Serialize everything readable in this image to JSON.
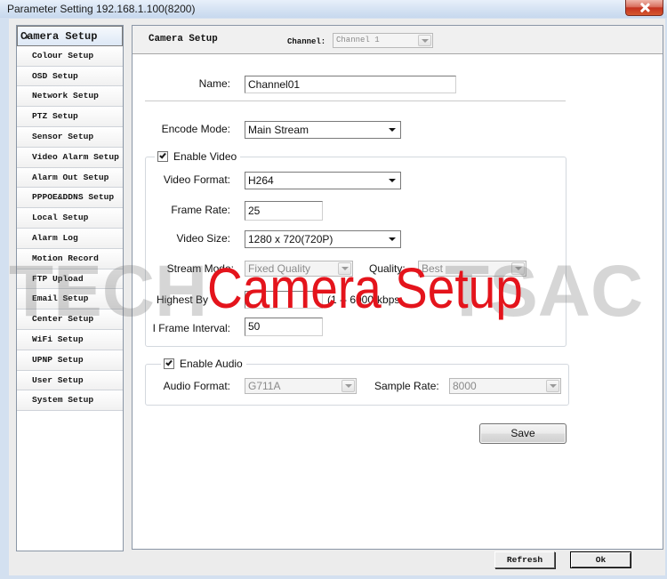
{
  "window": {
    "title": "Parameter Setting 192.168.1.100(8200)",
    "close_icon": "close-icon"
  },
  "sidebar": {
    "selected_icon": "triangle-right-icon",
    "items": [
      {
        "label": "Camera Setup",
        "selected": true
      },
      {
        "label": "Colour Setup"
      },
      {
        "label": "OSD Setup"
      },
      {
        "label": "Network Setup"
      },
      {
        "label": "PTZ Setup"
      },
      {
        "label": "Sensor Setup"
      },
      {
        "label": "Video Alarm Setup"
      },
      {
        "label": "Alarm Out Setup"
      },
      {
        "label": "PPPOE&DDNS Setup"
      },
      {
        "label": "Local Setup"
      },
      {
        "label": "Alarm Log"
      },
      {
        "label": "Motion Record"
      },
      {
        "label": "FTP Upload"
      },
      {
        "label": "Email Setup"
      },
      {
        "label": "Center Setup"
      },
      {
        "label": "WiFi Setup"
      },
      {
        "label": "UPNP Setup"
      },
      {
        "label": "User Setup"
      },
      {
        "label": "System Setup"
      }
    ]
  },
  "header": {
    "title": "Camera Setup",
    "channel_label": "Channel:",
    "channel_value": "Channel 1",
    "channel_disabled": true
  },
  "form": {
    "name_label": "Name:",
    "name_value": "Channel01",
    "encode_mode_label": "Encode Mode:",
    "encode_mode_value": "Main Stream",
    "video": {
      "enable_label": "Enable Video",
      "enabled": true,
      "video_format_label": "Video Format:",
      "video_format_value": "H264",
      "frame_rate_label": "Frame Rate:",
      "frame_rate_value": "25",
      "video_size_label": "Video Size:",
      "video_size_value": "1280 x 720(720P)",
      "stream_mode_label": "Stream Mode:",
      "stream_mode_value": "Fixed Quality",
      "quality_label": "Quality:",
      "quality_value": "Best",
      "highest_bitrate_label": "Highest By",
      "bitrate_range": "(1 -- 6000)kbps",
      "i_frame_label": "I Frame Interval:",
      "i_frame_value": "50"
    },
    "audio": {
      "enable_label": "Enable Audio",
      "enabled": true,
      "audio_format_label": "Audio Format:",
      "audio_format_value": "G711A",
      "sample_rate_label": "Sample Rate:",
      "sample_rate_value": "8000"
    },
    "save_label": "Save"
  },
  "footer": {
    "refresh_label": "Refresh",
    "ok_label": "Ok"
  },
  "overlay": {
    "caption": "Camera Setup",
    "caption_color": "#e4141c",
    "watermark_left": "TECH",
    "watermark_right": "TSAC"
  }
}
